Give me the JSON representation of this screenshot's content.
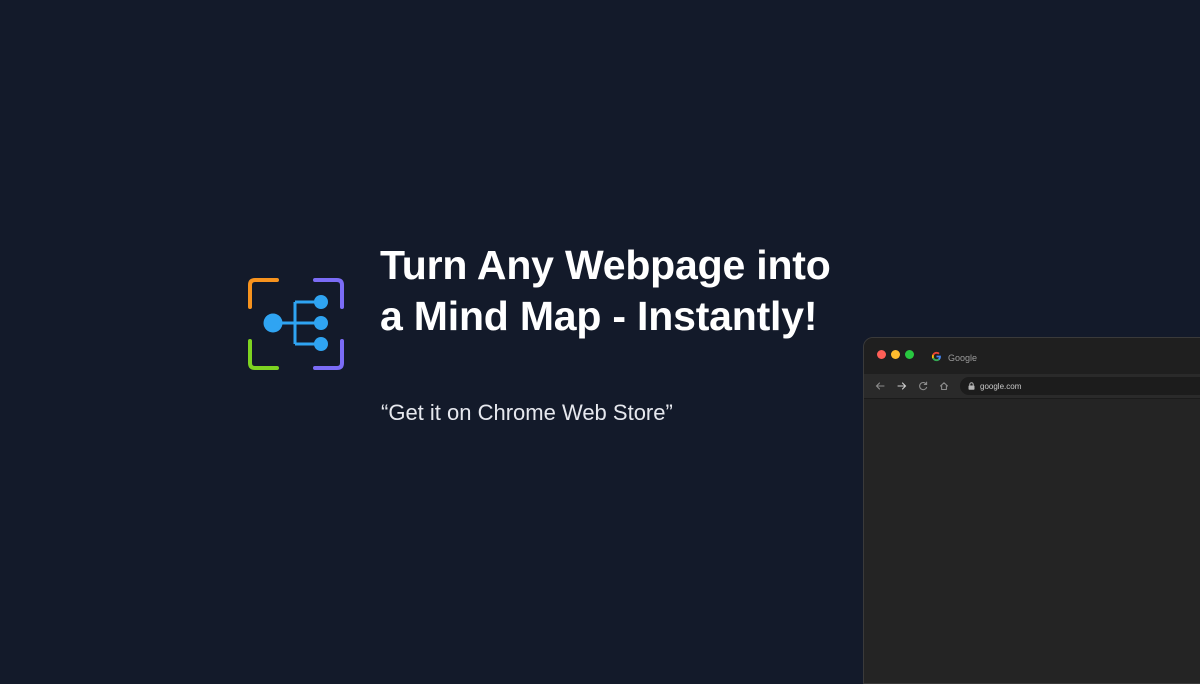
{
  "hero": {
    "headline": "Turn Any Webpage into a Mind Map - Instantly!",
    "tagline": "“Get it on Chrome Web Store”"
  },
  "logo": {
    "icon": "mind-map-logo-icon",
    "colors": {
      "orange": "#f7931e",
      "purple": "#7b6cf6",
      "green": "#7ed321",
      "blue": "#2fa4f2"
    }
  },
  "browser": {
    "tab": {
      "title": "Google",
      "favicon": "google-favicon-icon"
    },
    "address": {
      "url": "google.com",
      "icon": "lock-icon"
    },
    "window_controls": [
      "close-dot",
      "minimize-dot",
      "maximize-dot"
    ]
  },
  "colors": {
    "background": "#131a2a",
    "browser_frame": "#242424",
    "headline": "#ffffff"
  }
}
